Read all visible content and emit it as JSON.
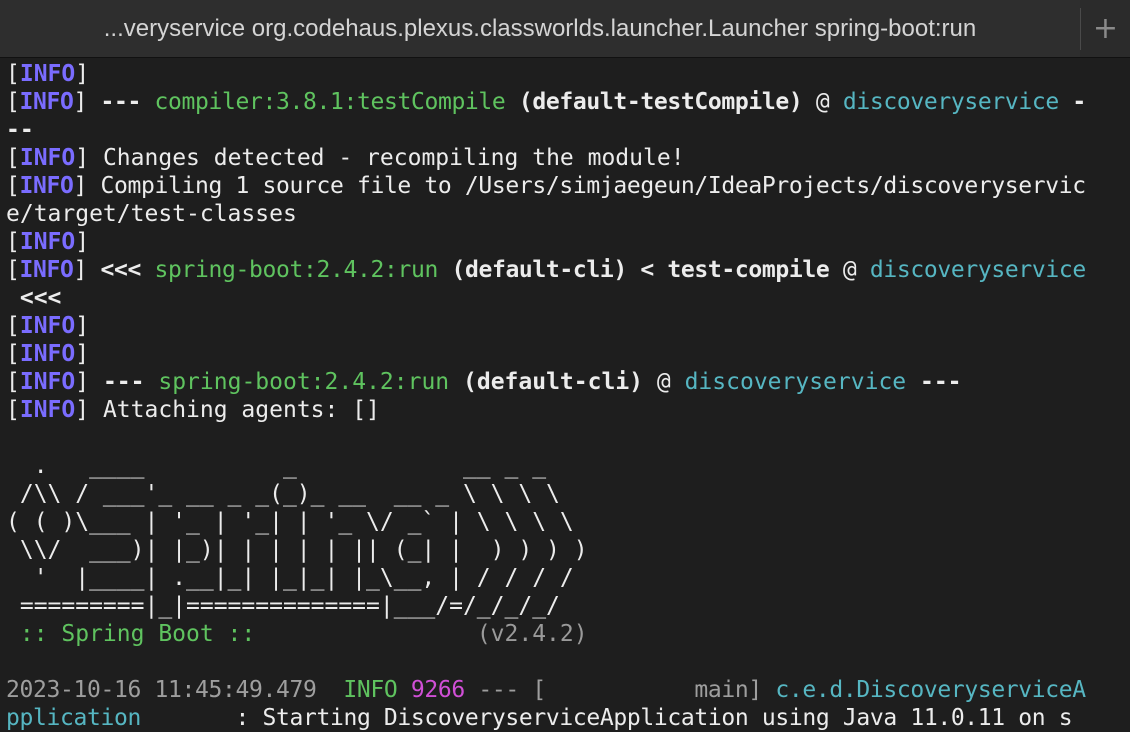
{
  "window": {
    "tab_title": "...veryservice org.codehaus.plexus.classworlds.launcher.Launcher spring-boot:run",
    "new_tab_symbol": "+"
  },
  "colors": {
    "background": "#1e1e1e",
    "info_tag": "#7a6cff",
    "green": "#5fc35f",
    "cyan": "#56b6c2",
    "pid_magenta": "#d04fd6"
  },
  "terminal": {
    "bracket_open": "[",
    "bracket_close": "]",
    "info_tag": "INFO",
    "lines": {
      "l3_dashes": " --- ",
      "l3_plugin": "compiler:3.8.1:testCompile",
      "l3_exec": " (default-testCompile)",
      "l3_at": " @ ",
      "l3_project": "discoveryservice",
      "l3_tail": " -",
      "l4": "--",
      "l5": " Changes detected - recompiling the module!",
      "l6": " Compiling 1 source file to /Users/simjaegeun/IdeaProjects/discoveryservic",
      "l7": "e/target/test-classes",
      "l9_arrows": " <<< ",
      "l9_plugin": "spring-boot:2.4.2:run",
      "l9_exec": " (default-cli) < test-compile",
      "l9_at": " @ ",
      "l9_project": "discoveryservice",
      "l10": " <<<",
      "l13_dashes": " --- ",
      "l13_plugin": "spring-boot:2.4.2:run",
      "l13_exec": " (default-cli)",
      "l13_at": " @ ",
      "l13_project": "discoveryservice",
      "l13_tail": " ---",
      "l14": " Attaching agents: []"
    },
    "banner": [
      "  .   ____          _            __ _ _",
      " /\\\\ / ___'_ __ _ _(_)_ __  __ _ \\ \\ \\ \\",
      "( ( )\\___ | '_ | '_| | '_ \\/ _` | \\ \\ \\ \\",
      " \\\\/  ___)| |_)| | | | | || (_| |  ) ) ) )",
      "  '  |____| .__|_| |_|_| |_\\__, | / / / /",
      " =========|_|==============|___/=/_/_/_/"
    ],
    "spring_boot_label": " :: Spring Boot :: ",
    "spring_boot_version": "               (v2.4.2)",
    "log": {
      "timestamp": "2023-10-16 11:45:49.479",
      "level": "  INFO ",
      "pid": "9266",
      "sep": " --- [           main] ",
      "logger_part1": "c.e.d.DiscoveryserviceA",
      "logger_part2": "pplication",
      "message": "       : Starting DiscoveryserviceApplication using Java 11.0.11 on s"
    }
  }
}
